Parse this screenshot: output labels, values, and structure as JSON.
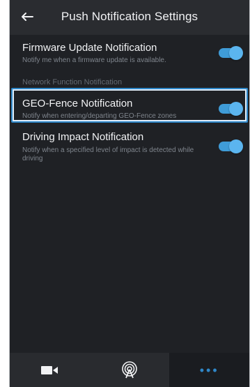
{
  "header": {
    "title": "Push Notification Settings"
  },
  "settings": {
    "items": [
      {
        "title": "Firmware Update Notification",
        "subtitle": "Notify me when a firmware update is available.",
        "enabled": true
      },
      {
        "section_header": "Network Function Notification"
      },
      {
        "title": "GEO-Fence Notification",
        "subtitle": "Notify when entering/departing GEO-Fence zones",
        "enabled": true
      },
      {
        "title": "Driving Impact Notification",
        "subtitle": "Notify when a specified level of impact is detected while driving",
        "enabled": true
      }
    ]
  },
  "bottom_nav": {
    "items": [
      {
        "icon": "video-camera-icon"
      },
      {
        "icon": "wireless-signal-icon"
      },
      {
        "icon": "more-icon",
        "label": "•••",
        "active": true
      }
    ]
  },
  "colors": {
    "accent": "#2f87c8",
    "toggle_on": "#3f9cd8"
  }
}
